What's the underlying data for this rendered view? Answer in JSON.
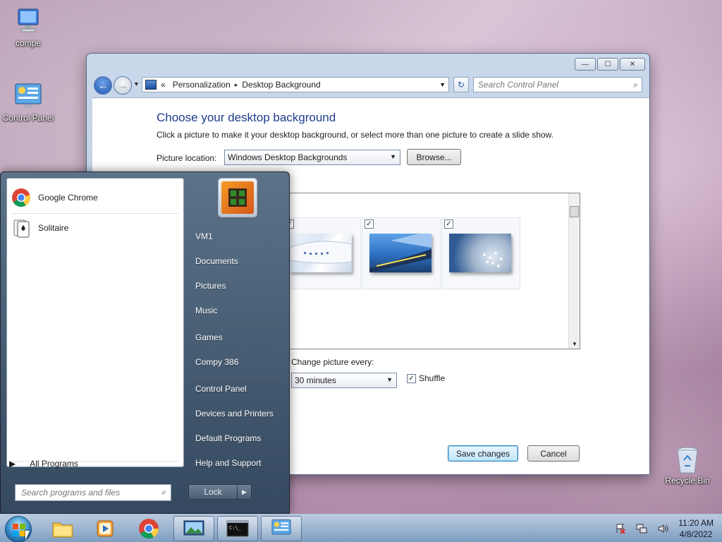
{
  "desktop": {
    "icons": [
      {
        "label": "compe",
        "icon": "computer-icon"
      },
      {
        "label": "Control Panel",
        "icon": "control-panel-icon"
      },
      {
        "label": "Recycle Bin",
        "icon": "recycle-bin-icon"
      }
    ]
  },
  "window": {
    "controls": {
      "minimize": "—",
      "maximize": "☐",
      "close": "✕"
    },
    "breadcrumb": {
      "prefix": "«",
      "items": [
        "Personalization",
        "Desktop Background"
      ],
      "separator": "▸"
    },
    "search_placeholder": "Search Control Panel",
    "heading": "Choose your desktop background",
    "description": "Click a picture to make it your desktop background, or select more than one picture to create a slide show.",
    "picture_location_label": "Picture location:",
    "picture_location_value": "Windows Desktop Backgrounds",
    "browse_label": "Browse...",
    "thumbnails": [
      {
        "checked": true,
        "theme": "architecture-1"
      },
      {
        "checked": true,
        "theme": "architecture-2"
      },
      {
        "checked": true,
        "theme": "architecture-3"
      },
      {
        "checked": true,
        "theme": "architecture-4"
      }
    ],
    "change_picture_label": "Change picture every:",
    "interval_value": "30 minutes",
    "shuffle_label": "Shuffle",
    "shuffle_checked": true,
    "save_label": "Save changes",
    "cancel_label": "Cancel"
  },
  "start_menu": {
    "pinned": [
      {
        "label": "Google Chrome",
        "icon": "chrome-icon"
      },
      {
        "label": "Solitaire",
        "icon": "solitaire-icon"
      }
    ],
    "all_programs": "All Programs",
    "search_placeholder": "Search programs and files",
    "right_items": [
      "VM1",
      "Documents",
      "Pictures",
      "Music",
      "Games",
      "Compy 386",
      "Control Panel",
      "Devices and Printers",
      "Default Programs",
      "Help and Support"
    ],
    "lock_label": "Lock"
  },
  "taskbar": {
    "pinned": [
      "explorer-icon",
      "media-player-icon",
      "chrome-icon",
      "personalization-icon",
      "cmd-icon",
      "control-panel-icon"
    ],
    "clock_time": "11:20 AM",
    "clock_date": "4/8/2022"
  }
}
